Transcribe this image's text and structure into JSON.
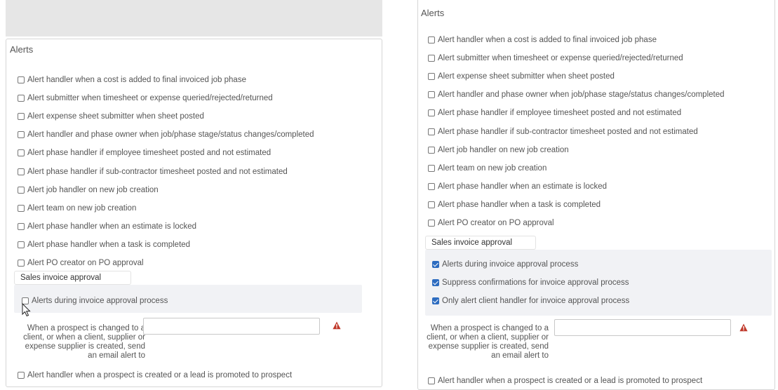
{
  "left": {
    "title": "Alerts",
    "items": [
      {
        "label": "Alert handler when a cost is added to final invoiced job phase",
        "checked": false
      },
      {
        "label": "Alert submitter when timesheet or expense queried/rejected/returned",
        "checked": false
      },
      {
        "label": "Alert expense sheet submitter when sheet posted",
        "checked": false
      },
      {
        "label": "Alert handler and phase owner when job/phase stage/status changes/completed",
        "checked": false
      },
      {
        "label": "Alert phase handler if employee timesheet posted and not estimated",
        "checked": false
      },
      {
        "label": "Alert phase handler if sub-contractor timesheet posted and not estimated",
        "checked": false
      },
      {
        "label": "Alert job handler on new job creation",
        "checked": false
      },
      {
        "label": "Alert team on new job creation",
        "checked": false
      },
      {
        "label": "Alert phase handler when an estimate is locked",
        "checked": false
      },
      {
        "label": "Alert phase handler when a task is completed",
        "checked": false
      },
      {
        "label": "Alert PO creator on PO approval",
        "checked": false
      }
    ],
    "sales_invoice": {
      "title": "Sales invoice approval",
      "items": [
        {
          "label": "Alerts during invoice approval process",
          "checked": false
        }
      ]
    },
    "prospect_label": "When a prospect is changed to a client, or when a client, supplier or expense supplier is created, send an email alert to",
    "prospect_value": "",
    "last_item": {
      "label": "Alert handler when a prospect is created or a lead is promoted to prospect",
      "checked": false
    }
  },
  "right": {
    "title": "Alerts",
    "items": [
      {
        "label": "Alert handler when a cost is added to final invoiced job phase",
        "checked": false
      },
      {
        "label": "Alert submitter when timesheet or expense queried/rejected/returned",
        "checked": false
      },
      {
        "label": "Alert expense sheet submitter when sheet posted",
        "checked": false
      },
      {
        "label": "Alert handler and phase owner when job/phase stage/status changes/completed",
        "checked": false
      },
      {
        "label": "Alert phase handler if employee timesheet posted and not estimated",
        "checked": false
      },
      {
        "label": "Alert phase handler if sub-contractor timesheet posted and not estimated",
        "checked": false
      },
      {
        "label": "Alert job handler on new job creation",
        "checked": false
      },
      {
        "label": "Alert team on new job creation",
        "checked": false
      },
      {
        "label": "Alert phase handler when an estimate is locked",
        "checked": false
      },
      {
        "label": "Alert phase handler when a task is completed",
        "checked": false
      },
      {
        "label": "Alert PO creator on PO approval",
        "checked": false
      }
    ],
    "sales_invoice": {
      "title": "Sales invoice approval",
      "items": [
        {
          "label": "Alerts during invoice approval process",
          "checked": true
        },
        {
          "label": "Suppress confirmations for invoice approval process",
          "checked": true
        },
        {
          "label": "Only alert client handler for invoice approval process",
          "checked": true
        }
      ]
    },
    "prospect_label": "When a prospect is changed to a client, or when a client, supplier or expense supplier is created, send an email alert to",
    "prospect_value": "",
    "last_item": {
      "label": "Alert handler when a prospect is created or a lead is promoted to prospect",
      "checked": false
    }
  },
  "colors": {
    "checkbox_checked": "#2d6cc0",
    "warning": "#c0392b",
    "subsection_bg": "#f1f2f5",
    "top_bar": "#e6e6e6"
  },
  "icons": {
    "warning": "warning-triangle-icon",
    "cursor": "mouse-pointer-icon"
  }
}
